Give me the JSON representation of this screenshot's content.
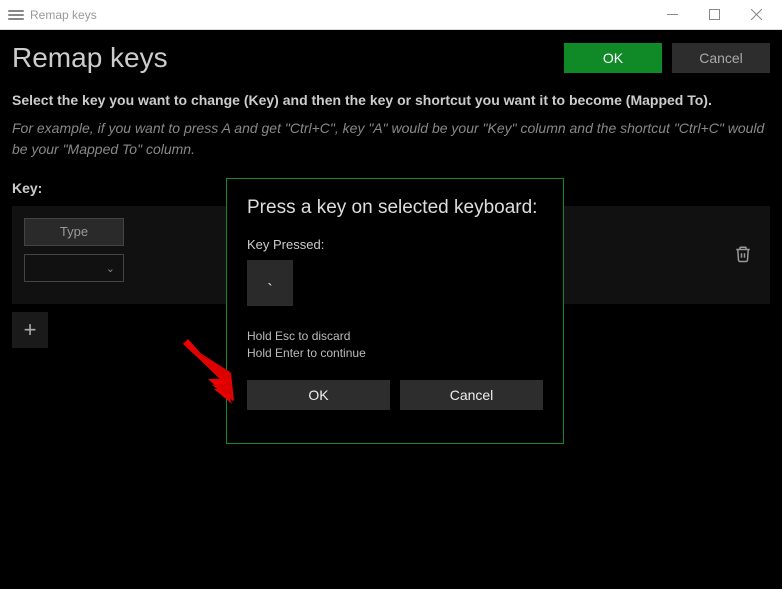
{
  "titlebar": {
    "title": "Remap keys"
  },
  "header": {
    "title": "Remap keys",
    "ok_label": "OK",
    "cancel_label": "Cancel"
  },
  "instructions": {
    "bold": "Select the key you want to change (Key) and then the key or shortcut you want it to become (Mapped To).",
    "italic": "For example, if you want to press A and get \"Ctrl+C\", key \"A\" would be your \"Key\" column and the shortcut \"Ctrl+C\" would be your \"Mapped To\" column."
  },
  "key_section": {
    "label": "Key:",
    "type_label": "Type"
  },
  "add_label": "+",
  "modal": {
    "title": "Press a key on selected keyboard:",
    "keypressed_label": "Key Pressed:",
    "keypressed_value": "`",
    "hint_line1": "Hold Esc to discard",
    "hint_line2": "Hold Enter to continue",
    "ok_label": "OK",
    "cancel_label": "Cancel"
  }
}
